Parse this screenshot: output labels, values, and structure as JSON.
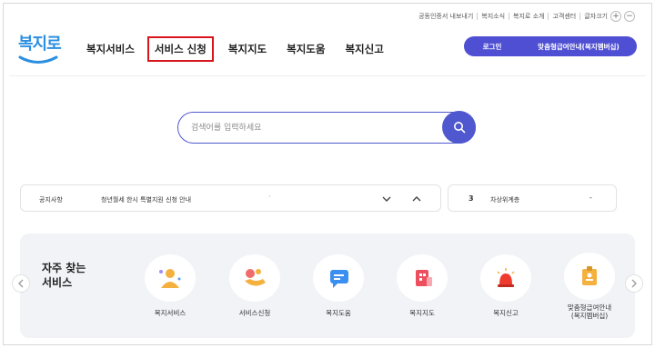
{
  "header": {
    "utility_links": [
      "공동인증서 내보내기",
      "복지소식",
      "복지로 소개",
      "고객센터",
      "글자크기"
    ],
    "font_plus": "+",
    "font_minus": "−",
    "logo_text": "복지로",
    "gnb": [
      "복지서비스",
      "서비스 신청",
      "복지지도",
      "복지도움",
      "복지신고"
    ],
    "active_gnb": "서비스 신청",
    "login_label": "로그인",
    "custom_label": "맞춤형급여안내(복지멤버십)"
  },
  "search": {
    "placeholder": "검색어를 입력하세요"
  },
  "notice": {
    "label": "공지사항",
    "text": "청년월세 한시 특별지원 신청 안내",
    "dot": "·"
  },
  "rank": {
    "number": "3",
    "text": "차상위계층",
    "dash": "-"
  },
  "frequent": {
    "title_line1": "자주 찾는",
    "title_line2": "서비스",
    "items": [
      {
        "name": "복지서비스",
        "icon": "person-icon"
      },
      {
        "name": "서비스신청",
        "icon": "hand-icon"
      },
      {
        "name": "복지도움",
        "icon": "chat-icon"
      },
      {
        "name": "복지지도",
        "icon": "map-icon"
      },
      {
        "name": "복지신고",
        "icon": "siren-icon"
      },
      {
        "name": "맞춤형급여안내\n(복지멤버십)",
        "icon": "badge-icon"
      }
    ]
  },
  "colors": {
    "accent": "#4f58cf",
    "active_outline": "#d8141c",
    "logo": "#2c8fe0"
  }
}
